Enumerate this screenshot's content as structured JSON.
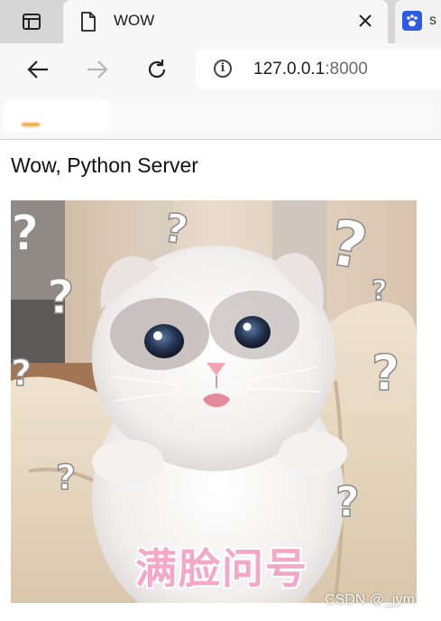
{
  "browser": {
    "active_tab_title": "WOW",
    "next_tab_title": "s",
    "address": {
      "host": "127.0.0.1",
      "port": ":8000"
    }
  },
  "page": {
    "heading": "Wow, Python Server",
    "image": {
      "overlay_caption": "满脸问号",
      "question_marks": "?"
    }
  },
  "watermark": "CSDN @_jym",
  "colors": {
    "tabstrip": "#d6d6d6",
    "toolbar": "#f7f7f7",
    "caption_pink": "#f4a7c6",
    "baidu_blue": "#2f5be4"
  }
}
